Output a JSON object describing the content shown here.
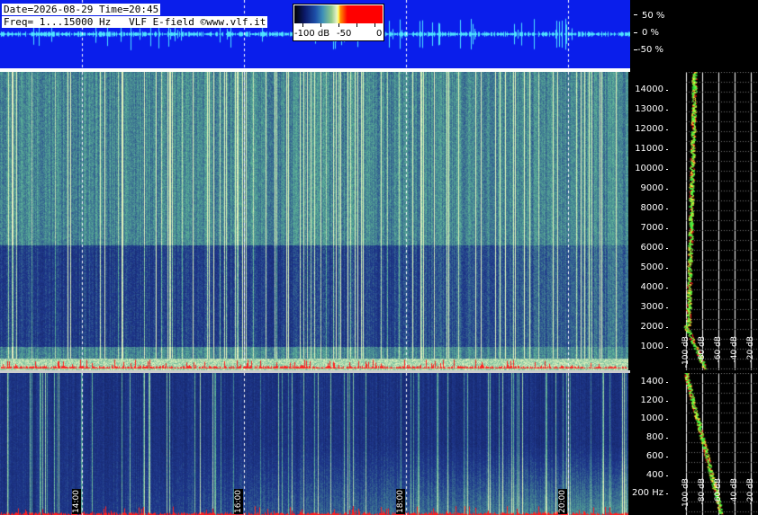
{
  "header": {
    "date_line": "Date=2026-08-29 Time=20:45",
    "freq_line": "Freq= 1...15000 Hz   VLF E-field ©www.vlf.it"
  },
  "legend": {
    "labels": [
      "-100 dB",
      "-50",
      "0"
    ]
  },
  "amplitude_scale": [
    "50 %",
    "0 %",
    "-50 %"
  ],
  "freq_axis_top": [
    "14000",
    "13000",
    "12000",
    "11000",
    "10000",
    "9000",
    "8000",
    "7000",
    "6000",
    "5000",
    "4000",
    "3000",
    "2000",
    "1000"
  ],
  "freq_axis_bottom": [
    "1400",
    "1200",
    "1000",
    "800",
    "600",
    "400",
    "200 Hz"
  ],
  "time_labels": [
    "14:00",
    "16:00",
    "18:00",
    "20:00"
  ],
  "db_labels_top": [
    "-100 dB",
    "-80 dB",
    "-60 dB",
    "-40 dB",
    "-20 dB"
  ],
  "db_labels_bottom": [
    "-100 dB",
    "-80 dB",
    "-60 dB",
    "-40 dB",
    "-20 dB"
  ],
  "colors": {
    "waveband_bg": "#0a1eeb",
    "wave_trace": "#4fe3ff",
    "spectrum_dark": "#1c2a6e",
    "spectrum_bright": "#9fe0b0",
    "noise_red": "#ff2020"
  }
}
